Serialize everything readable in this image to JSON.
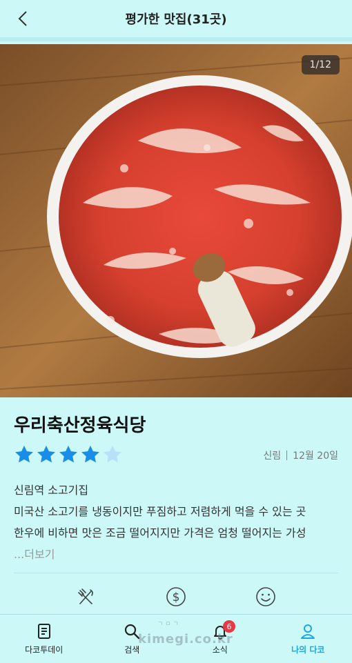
{
  "header": {
    "title": "평가한 맛집(31곳)"
  },
  "photo": {
    "counter": "1/12"
  },
  "restaurant": {
    "name": "우리축산정육식당",
    "rating": 4,
    "rating_max": 5,
    "location": "신림",
    "date": "12월 20일",
    "desc_lines": [
      "신림역 소고기집",
      "미국산 소고기를 냉동이지만 푸짐하고 저렴하게 먹을 수 있는 곳",
      "한우에 비하면 맛은 조금 떨어지지만 가격은 엄청 떨어지는 가성"
    ],
    "more_label": "...더보기"
  },
  "actions": [
    "fork-knife-icon",
    "dollar-icon",
    "smile-icon"
  ],
  "nav": {
    "items": [
      {
        "label": "다코투데이",
        "icon": "document-icon"
      },
      {
        "label": "검색",
        "icon": "search-icon"
      },
      {
        "label": "소식",
        "icon": "bell-icon",
        "badge": "6"
      },
      {
        "label": "나의 다코",
        "icon": "user-icon",
        "active": true
      }
    ]
  },
  "watermark": {
    "text": "kimegi.co.kr",
    "small": "ㄱㅁㄱ"
  },
  "colors": {
    "accent": "#1aa6e6",
    "star": "#1a8ee6",
    "star_empty": "#b8e0f8",
    "background": "#ccf8f8"
  }
}
